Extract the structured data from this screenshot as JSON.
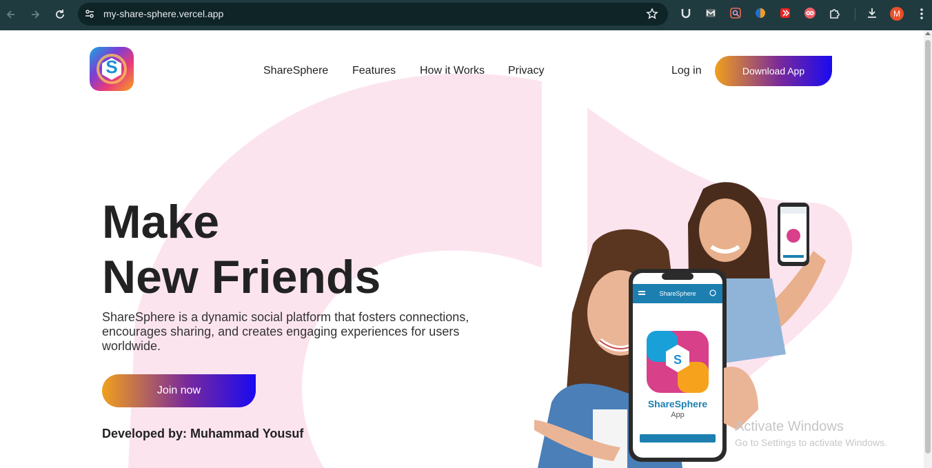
{
  "browser": {
    "url": "my-share-sphere.vercel.app",
    "profile_initial": "M",
    "icons": [
      "back-icon",
      "forward-icon",
      "reload-icon",
      "tune-icon",
      "star-icon",
      "ublock-icon",
      "gmail-ext-icon",
      "search-ext-icon",
      "dark-ext-icon",
      "red-ext-icon",
      "infinity-ext-icon",
      "puzzle-icon",
      "download-icon",
      "kebab-menu-icon"
    ]
  },
  "header": {
    "logo_letter": "S",
    "nav": [
      "ShareSphere",
      "Features",
      "How it Works",
      "Privacy"
    ],
    "login": "Log in",
    "download": "Download App"
  },
  "hero": {
    "title_line1": "Make",
    "title_line2": "New Friends",
    "description": "ShareSphere is a dynamic social platform that fosters connections, encourages sharing, and creates engaging experiences for users worldwide.",
    "cta": "Join now",
    "developer": "Developed by: Muhammad Yousuf"
  },
  "phone": {
    "app_bar": "ShareSphere",
    "app_name": "ShareSphere",
    "app_sub": "App"
  },
  "watermark": {
    "line1": "Activate Windows",
    "line2": "Go to Settings to activate Windows."
  },
  "colors": {
    "chrome": "#1f3b3f",
    "gradient_start": "#f0a01c",
    "gradient_end": "#1a0af0",
    "bg_shape": "#fce4ef"
  }
}
